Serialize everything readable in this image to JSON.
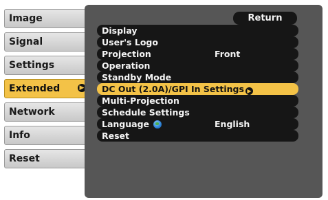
{
  "tabs": [
    {
      "label": "Image"
    },
    {
      "label": "Signal"
    },
    {
      "label": "Settings"
    },
    {
      "label": "Extended"
    },
    {
      "label": "Network"
    },
    {
      "label": "Info"
    },
    {
      "label": "Reset"
    }
  ],
  "active_tab": "Extended",
  "return_label": "Return",
  "menu": [
    {
      "label": "Display",
      "value": ""
    },
    {
      "label": "User's Logo",
      "value": ""
    },
    {
      "label": "Projection",
      "value": "Front"
    },
    {
      "label": "Operation",
      "value": ""
    },
    {
      "label": "Standby Mode",
      "value": ""
    },
    {
      "label": "DC Out (2.0A)/GPI In Settings",
      "value": ""
    },
    {
      "label": "Multi-Projection",
      "value": ""
    },
    {
      "label": "Schedule Settings",
      "value": ""
    },
    {
      "label": "Language",
      "value": "English"
    },
    {
      "label": "Reset",
      "value": ""
    }
  ],
  "colors": {
    "highlight": "#f3c247",
    "panel": "#565656",
    "row": "#161616"
  },
  "icons": {
    "cursor": "enter-cursor-icon",
    "language": "globe-icon"
  }
}
